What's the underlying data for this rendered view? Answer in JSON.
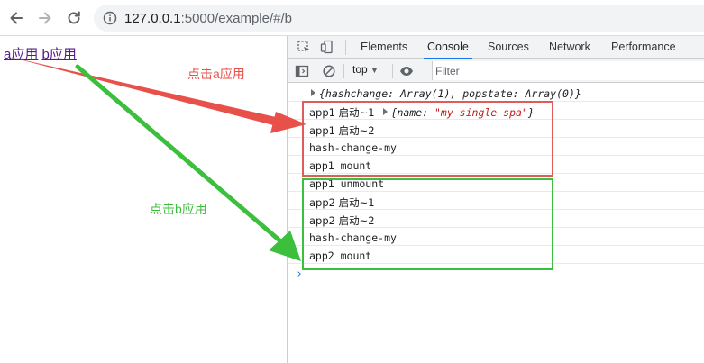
{
  "browser": {
    "url_host": "127.0.0.1",
    "url_path": ":5000/example/#/b"
  },
  "page": {
    "link_a": "a应用",
    "link_b": "b应用",
    "annotation_a": "点击a应用",
    "annotation_b": "点击b应用"
  },
  "devtools": {
    "tabs": [
      "Elements",
      "Console",
      "Sources",
      "Network",
      "Performance"
    ],
    "active_tab": "Console",
    "context": "top",
    "filter_placeholder": "Filter",
    "console_lines": {
      "line0": "{hashchange: Array(1), popstate: Array(0)}",
      "line1_prefix": "app1 启动~1",
      "line1_obj_key": "{name: ",
      "line1_obj_val": "\"my single spa\"",
      "line1_obj_end": "}",
      "line2": "app1 启动~2",
      "line3": "hash-change-my",
      "line4": "app1 mount",
      "line5": "app1 unmount",
      "line6": "app2 启动~1",
      "line7": "app2 启动~2",
      "line8": "hash-change-my",
      "line9": "app2 mount"
    }
  },
  "colors": {
    "red_annotation": "#e8504a",
    "green_annotation": "#3cbf3c",
    "accent": "#1a73e8"
  }
}
